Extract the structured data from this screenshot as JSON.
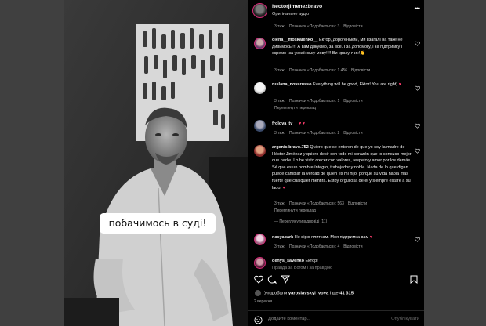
{
  "post": {
    "author": "hectorjimenezbravo",
    "audio": "Оригінальне аудіо",
    "caption_sticker": "побачимось в суді!"
  },
  "top_meta": {
    "time": "3 тиж.",
    "likes": "Позначки «Подобається»: 3",
    "reply": "Відповісти"
  },
  "comments": [
    {
      "user": "olena__moskalenko__",
      "text": "Ектор, дорогенький, ми взагалі на таке не дивимось!!!! А вам дякуємо, за все. І за допомогу, і за підтримку і скремо- за українську мову!!!! Ви красунчик!👏",
      "time": "3 тиж.",
      "likes": "Позначки «Подобається»: 1 456",
      "reply": "Відповісти",
      "avatar_color": "#7a4b8c"
    },
    {
      "user": "ruslana_novarusso",
      "text": "Everything will be good, Ektor! You are right)",
      "time": "3 тиж.",
      "likes": "Позначки «Подобається»: 1",
      "reply": "Відповісти",
      "translate": "Переглянути переклад",
      "avatar_color": "#e9e9e9"
    },
    {
      "user": "frolova_tv__",
      "text": "",
      "time": "3 тиж.",
      "likes": "Позначки «Подобається»: 2",
      "reply": "Відповісти",
      "avatar_color": "#5a6d8a"
    },
    {
      "user": "argenis.bravo.752",
      "text": "Quiero que se enteren de que yo soy la madre de Héctor Jiménez y quiero decir con todo mi corazón que lo conozco mejor que nadie. Lo he visto crecer con valores, respeto y amor por los demás. Sé que es un hombre íntegro, trabajador y noble. Nada de lo que digan puede cambiar la verdad de quién es mi hijo, porque su vida habla más fuerte que cualquier mentira. Estoy orgullosa de él y siempre estaré a su lado.",
      "time": "3 тиж.",
      "likes": "Позначки «Подобається»: 563",
      "reply": "Відповісти",
      "translate": "Переглянути переклад",
      "replies": "Переглянути відповіді (11)",
      "avatar_color": "#a34a3a"
    },
    {
      "user": "nasyapark",
      "text": "Не вірю плиткам. Моя підтримка вам",
      "time": "3 тиж.",
      "likes": "Позначки «Подобається»: 4",
      "reply": "Відповісти",
      "avatar_color": "#c6a0b8"
    },
    {
      "user": "denys_savenko",
      "text": "Ектор!",
      "subtext": "Правда за Богом і за правдою",
      "avatar_color": "#8b3b5b"
    }
  ],
  "likes_line": {
    "prefix": "Уподобали",
    "user": "yaroslavskyi_vova",
    "mid": "і ще",
    "count": "41 315"
  },
  "post_date": "2 вересня",
  "add_comment": {
    "placeholder": "Додайте коментар...",
    "publish": "Опублікувати"
  },
  "colors": {
    "heart": "#ff3040",
    "bg": "#000000",
    "muted": "#a8a8a8"
  }
}
